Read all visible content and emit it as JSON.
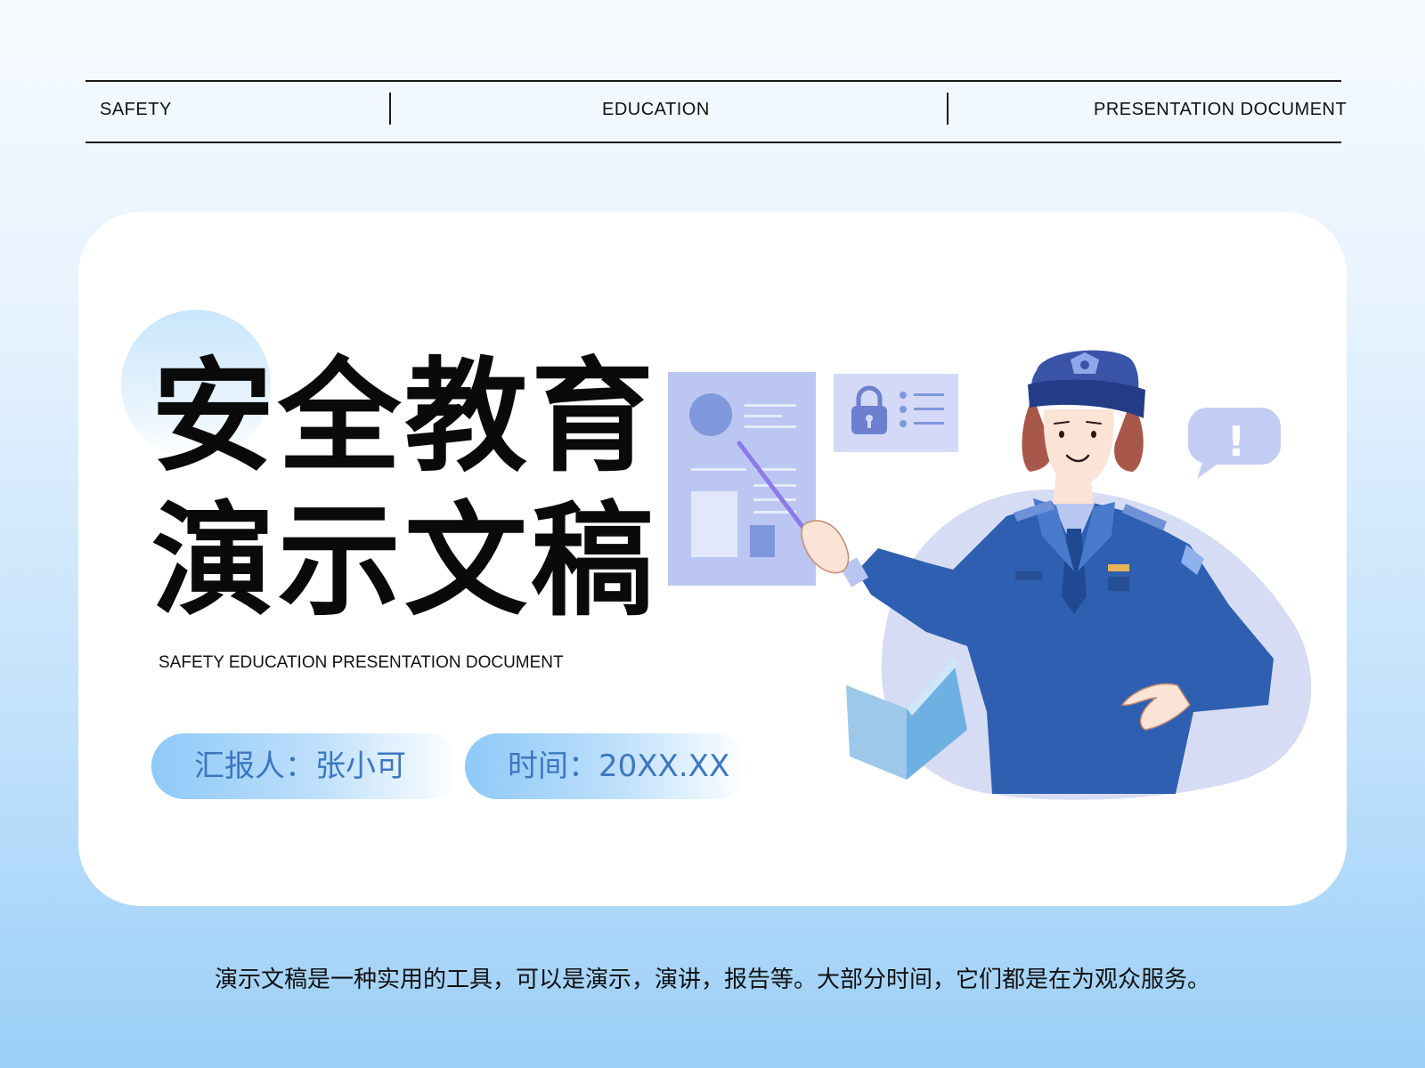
{
  "header": {
    "left": "SAFETY",
    "center": "EDUCATION",
    "right": "PRESENTATION DOCUMENT"
  },
  "title": {
    "line1": "安全教育",
    "line2": "演示文稿"
  },
  "subtitle": "SAFETY EDUCATION PRESENTATION DOCUMENT",
  "info": {
    "reporter": "汇报人：张小可",
    "time": "时间：20XX.XX"
  },
  "footer": "演示文稿是一种实用的工具，可以是演示，演讲，报告等。大部分时间，它们都是在为观众服务。",
  "illustration": {
    "alert_symbol": "!"
  },
  "colors": {
    "accent_blue": "#3c77c0",
    "uniform_blue": "#2e5fb0",
    "panel_lavender": "#bcc6f2"
  }
}
